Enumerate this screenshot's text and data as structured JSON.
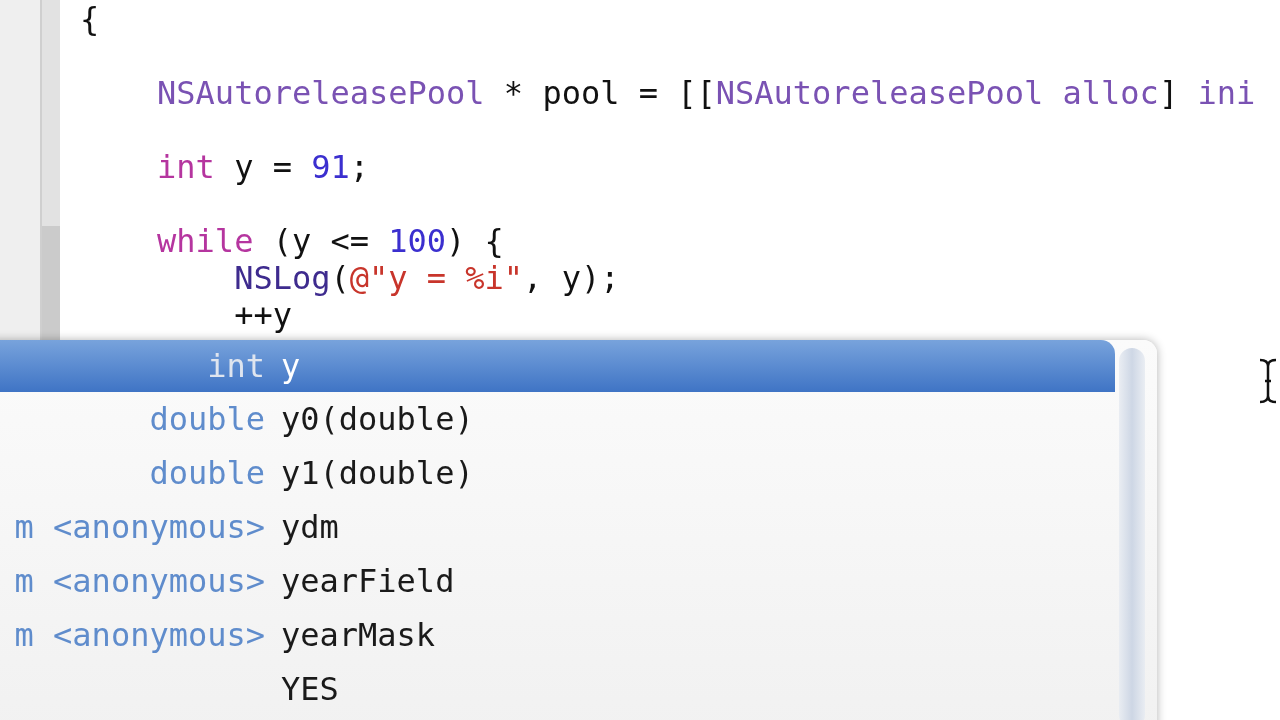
{
  "editor": {
    "lines": [
      {
        "kind": "code",
        "tokens": [
          {
            "kind": "plain",
            "text": "{"
          }
        ]
      },
      {
        "kind": "blank"
      },
      {
        "kind": "code",
        "tokens": [
          {
            "kind": "class",
            "text": "    NSAutoreleasePool"
          },
          {
            "kind": "plain",
            "text": " * pool = [["
          },
          {
            "kind": "class",
            "text": "NSAutoreleasePool"
          },
          {
            "kind": "method",
            "text": " alloc"
          },
          {
            "kind": "plain",
            "text": "] "
          },
          {
            "kind": "method",
            "text": "ini"
          }
        ]
      },
      {
        "kind": "blank"
      },
      {
        "kind": "code",
        "tokens": [
          {
            "kind": "keyword",
            "text": "    int"
          },
          {
            "kind": "plain",
            "text": " y = "
          },
          {
            "kind": "number",
            "text": "91"
          },
          {
            "kind": "plain",
            "text": ";"
          }
        ]
      },
      {
        "kind": "blank"
      },
      {
        "kind": "code",
        "tokens": [
          {
            "kind": "keyword",
            "text": "    while"
          },
          {
            "kind": "plain",
            "text": " (y <= "
          },
          {
            "kind": "number",
            "text": "100"
          },
          {
            "kind": "plain",
            "text": ") {"
          }
        ]
      },
      {
        "kind": "code",
        "tokens": [
          {
            "kind": "function",
            "text": "        NSLog"
          },
          {
            "kind": "plain",
            "text": "("
          },
          {
            "kind": "string",
            "text": "@\"y = %i\""
          },
          {
            "kind": "plain",
            "text": ", y);"
          }
        ]
      },
      {
        "kind": "code",
        "tokens": [
          {
            "kind": "plain",
            "text": "        ++y"
          }
        ]
      }
    ]
  },
  "completion": {
    "items": [
      {
        "type": "int",
        "name": "y",
        "selected": true
      },
      {
        "type": "double",
        "name": "y0(double)",
        "selected": false
      },
      {
        "type": "double",
        "name": "y1(double)",
        "selected": false
      },
      {
        "type": "m <anonymous>",
        "name": "ydm",
        "selected": false
      },
      {
        "type": "m <anonymous>",
        "name": "yearField",
        "selected": false
      },
      {
        "type": "m <anonymous>",
        "name": "yearMask",
        "selected": false
      },
      {
        "name": "YES",
        "selected": false
      }
    ]
  }
}
